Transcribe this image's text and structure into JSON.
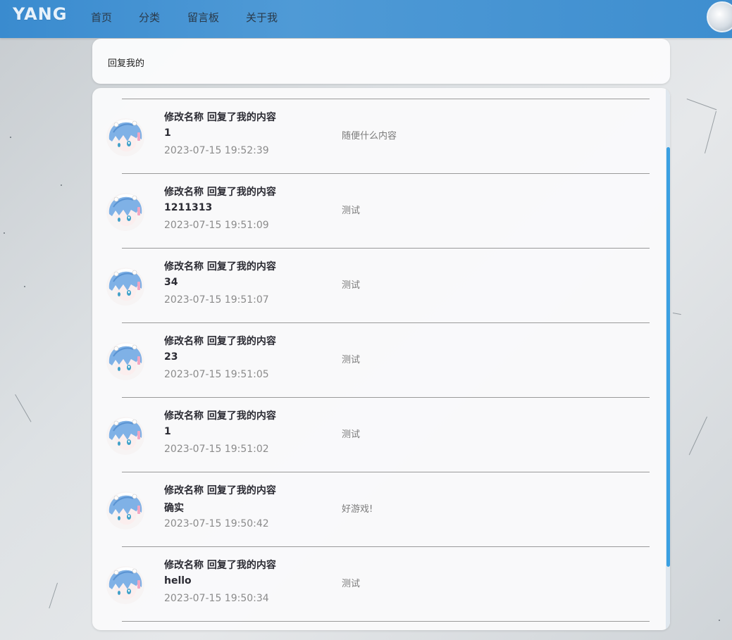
{
  "nav": {
    "logo": "YANG",
    "items": [
      "首页",
      "分类",
      "留言板",
      "关于我"
    ]
  },
  "page": {
    "title": "回复我的"
  },
  "replies": [
    {
      "title": "修改名称 回复了我的内容",
      "reply": "1",
      "time": "2023-07-15 19:52:39",
      "content": "随便什么内容"
    },
    {
      "title": "修改名称 回复了我的内容",
      "reply": "1211313",
      "time": "2023-07-15 19:51:09",
      "content": "测试"
    },
    {
      "title": "修改名称 回复了我的内容",
      "reply": "34",
      "time": "2023-07-15 19:51:07",
      "content": "测试"
    },
    {
      "title": "修改名称 回复了我的内容",
      "reply": "23",
      "time": "2023-07-15 19:51:05",
      "content": "测试"
    },
    {
      "title": "修改名称 回复了我的内容",
      "reply": "1",
      "time": "2023-07-15 19:51:02",
      "content": "测试"
    },
    {
      "title": "修改名称 回复了我的内容",
      "reply": "确实",
      "time": "2023-07-15 19:50:42",
      "content": "好游戏!"
    },
    {
      "title": "修改名称 回复了我的内容",
      "reply": "hello",
      "time": "2023-07-15 19:50:34",
      "content": "测试"
    }
  ],
  "colors": {
    "nav_bg": "#4a97d4",
    "scroll_thumb": "#3aa0e2",
    "muted_text": "#8b8b8b"
  },
  "icons": {
    "avatar": "anime-avatar-icon",
    "user_avatar": "user-avatar-icon"
  }
}
